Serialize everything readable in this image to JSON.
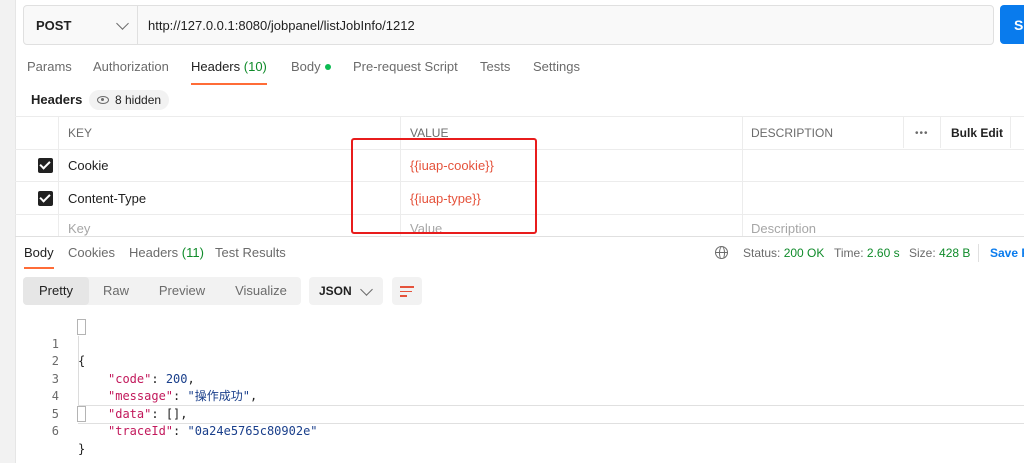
{
  "request": {
    "method": "POST",
    "url": "http://127.0.0.1:8080/jobpanel/listJobInfo/1212",
    "send_label": "S"
  },
  "request_tabs": {
    "params": "Params",
    "authorization": "Authorization",
    "headers": "Headers",
    "headers_count": "(10)",
    "body": "Body",
    "prerequest": "Pre-request Script",
    "tests": "Tests",
    "settings": "Settings"
  },
  "headers_section": {
    "label": "Headers",
    "hidden": "8 hidden"
  },
  "table": {
    "col_key": "KEY",
    "col_value": "VALUE",
    "col_description": "DESCRIPTION",
    "more": "•••",
    "bulk_edit": "Bulk Edit",
    "rows": [
      {
        "key": "Cookie",
        "value": "{{iuap-cookie}}"
      },
      {
        "key": "Content-Type",
        "value": "{{iuap-type}}"
      }
    ],
    "placeholder_key": "Key",
    "placeholder_value": "Value",
    "placeholder_description": "Description"
  },
  "response_tabs": {
    "body": "Body",
    "cookies": "Cookies",
    "headers": "Headers",
    "headers_count": "(11)",
    "test_results": "Test Results"
  },
  "response_status": {
    "status_label": "Status:",
    "status_value": "200 OK",
    "time_label": "Time:",
    "time_value": "2.60 s",
    "size_label": "Size:",
    "size_value": "428 B",
    "save": "Save R"
  },
  "format": {
    "pretty": "Pretty",
    "raw": "Raw",
    "preview": "Preview",
    "visualize": "Visualize",
    "language": "JSON"
  },
  "code_lines": [
    "1",
    "2",
    "3",
    "4",
    "5",
    "6"
  ],
  "code": {
    "open": "{",
    "code_key": "\"code\"",
    "code_val": "200",
    "message_key": "\"message\"",
    "message_val": "\"操作成功\"",
    "data_key": "\"data\"",
    "data_val": "[]",
    "trace_key": "\"traceId\"",
    "trace_val": "\"0a24e5765c80902e\"",
    "close": "}"
  },
  "colors": {
    "accent": "#ff6c37",
    "primary": "#097bed",
    "success": "#0f8b2a",
    "variable": "#e5533c",
    "highlight_box": "#e81c1c"
  }
}
